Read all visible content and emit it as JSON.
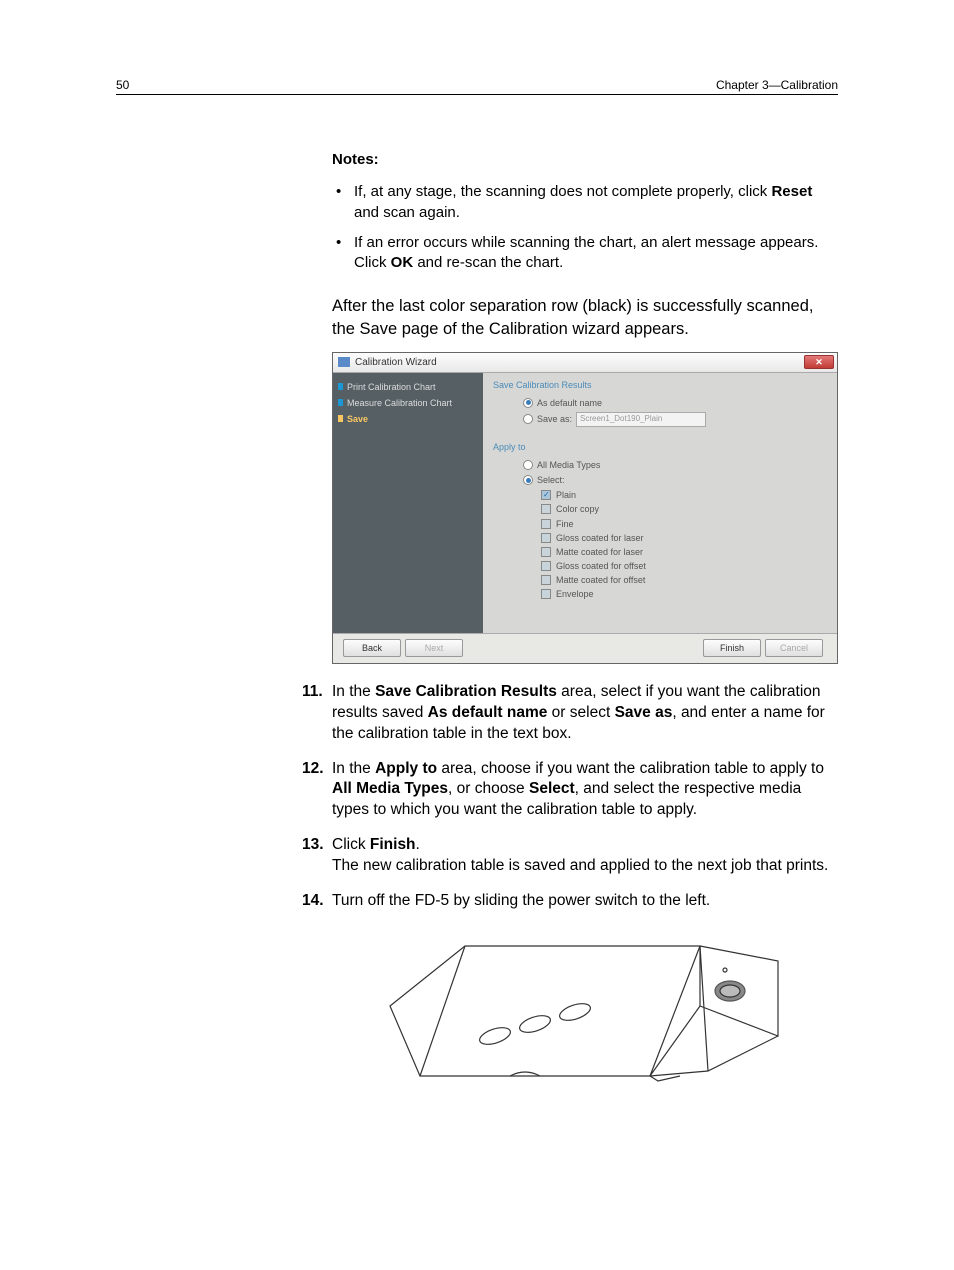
{
  "header": {
    "page_num": "50",
    "chapter": "Chapter 3—Calibration"
  },
  "notes": {
    "heading": "Notes:",
    "items": [
      {
        "pre": "If, at any stage, the scanning does not complete properly, click ",
        "bold": "Reset",
        "post": " and scan again."
      },
      {
        "pre": "If an error occurs while scanning the chart, an alert message appears. Click ",
        "bold": "OK",
        "post": " and re-scan the chart."
      }
    ]
  },
  "intro_para": "After the last color separation row (black) is successfully scanned, the Save page of the Calibration wizard appears.",
  "wizard": {
    "title": "Calibration Wizard",
    "sidebar": {
      "items": [
        "Print Calibration Chart",
        "Measure Calibration Chart",
        "Save"
      ]
    },
    "save_section": "Save Calibration Results",
    "opt_default": "As default name",
    "opt_saveas": "Save as:",
    "saveas_value": "Screen1_Dot190_Plain",
    "apply_label": "Apply to",
    "opt_all": "All Media Types",
    "opt_select": "Select:",
    "media": [
      "Plain",
      "Color copy",
      "Fine",
      "Gloss coated for laser",
      "Matte coated for laser",
      "Gloss coated for offset",
      "Matte coated for offset",
      "Envelope"
    ],
    "buttons": {
      "back": "Back",
      "next": "Next",
      "finish": "Finish",
      "cancel": "Cancel"
    }
  },
  "steps": {
    "s11_num": "11.",
    "s11_p1": "In the ",
    "s11_b1": "Save Calibration Results",
    "s11_p2": " area, select if you want the calibration results saved ",
    "s11_b2": "As default name",
    "s11_p3": " or select ",
    "s11_b3": "Save as",
    "s11_p4": ", and enter a name for the calibration table in the text box.",
    "s12_num": "12.",
    "s12_p1": "In the ",
    "s12_b1": "Apply to",
    "s12_p2": " area, choose if you want the calibration table to apply to ",
    "s12_b2": "All Media Types",
    "s12_p3": ", or choose ",
    "s12_b3": "Select",
    "s12_p4": ", and select the respective media types to which you want the calibration table to apply.",
    "s13_num": "13.",
    "s13_p1": "Click ",
    "s13_b1": "Finish",
    "s13_p2": ".",
    "s13_sub": "The new calibration table is saved and applied to the next job that prints.",
    "s14_num": "14.",
    "s14_text": "Turn off the FD-5 by sliding the power switch to the left."
  }
}
